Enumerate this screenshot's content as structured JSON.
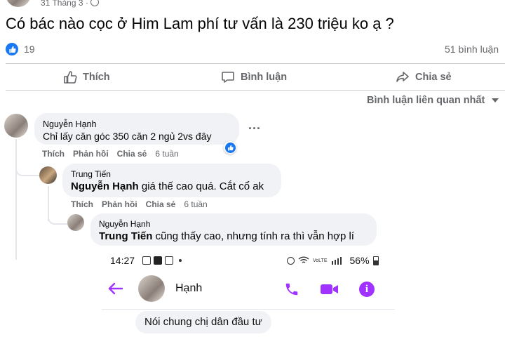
{
  "post": {
    "date": "31 Tháng 3 · ",
    "title": "Có bác nào cọc ở Him Lam phí tư vấn là 230 triệu ko ạ ?",
    "reactions_count": "19",
    "comments_count": "51 bình luận",
    "like_label": "Thích",
    "comment_label": "Bình luận",
    "share_label": "Chia sẻ",
    "sort_label": "Bình luận liên quan nhất"
  },
  "comments": [
    {
      "author": "Nguyễn Hạnh",
      "text": "Chỉ lấy căn góc 350 căn 2 ngủ 2vs đây",
      "actions": {
        "like": "Thích",
        "reply": "Phản hồi",
        "share": "Chia sẻ",
        "time": "6 tuần"
      }
    },
    {
      "author": "Trung Tiến",
      "mention": "Nguyễn Hạnh",
      "text": " giá thế cao quá. Cắt cổ ak",
      "actions": {
        "like": "Thích",
        "reply": "Phản hồi",
        "share": "Chia sẻ",
        "time": "6 tuần"
      }
    },
    {
      "author": "Nguyễn Hạnh",
      "mention": "Trung Tiến",
      "text": " cũng thấy cao, nhưng tính ra thì vẫn hợp lí"
    }
  ],
  "more_dots": "...",
  "messenger": {
    "time": "14:27",
    "battery": "56%",
    "contact_name": "Hạnh",
    "message": "Nói chung chị dân đầu tư"
  },
  "colors": {
    "accent": "#a033ff",
    "fb_blue": "#1877f2",
    "text": "#050505",
    "muted": "#65676b",
    "bubble": "#f0f2f5"
  },
  "icons": [
    "globe-icon",
    "like-reaction-icon",
    "thumbs-up-icon",
    "comment-icon",
    "share-icon",
    "chevron-down-icon",
    "back-arrow-icon",
    "phone-icon",
    "video-icon",
    "info-icon"
  ]
}
